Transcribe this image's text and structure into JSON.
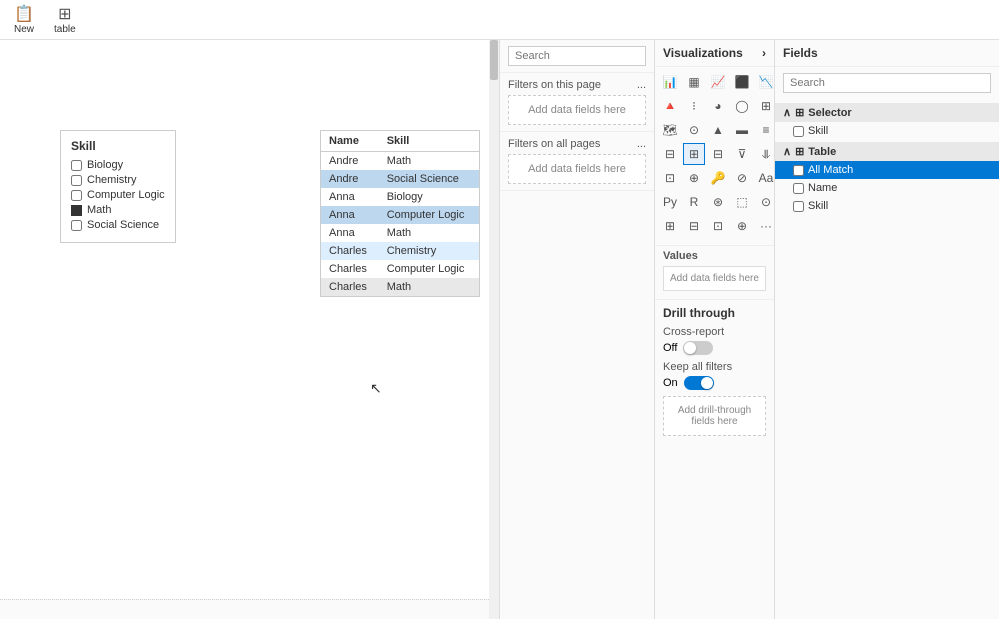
{
  "toolbar": {
    "new_button_label": "New",
    "table_button_label": "table"
  },
  "slicer": {
    "title": "Skill",
    "items": [
      {
        "label": "Biology",
        "checked": false
      },
      {
        "label": "Chemistry",
        "checked": false
      },
      {
        "label": "Computer Logic",
        "checked": false
      },
      {
        "label": "Math",
        "checked": true,
        "filled": true
      },
      {
        "label": "Social Science",
        "checked": false
      }
    ]
  },
  "table": {
    "columns": [
      "Name",
      "Skill"
    ],
    "rows": [
      {
        "name": "Andre",
        "skill": "Math",
        "highlight": ""
      },
      {
        "name": "Andre",
        "skill": "Social Science",
        "highlight": "blue"
      },
      {
        "name": "Anna",
        "skill": "Biology",
        "highlight": ""
      },
      {
        "name": "Anna",
        "skill": "Computer Logic",
        "highlight": "blue"
      },
      {
        "name": "Anna",
        "skill": "Math",
        "highlight": ""
      },
      {
        "name": "Charles",
        "skill": "Chemistry",
        "highlight": "light"
      },
      {
        "name": "Charles",
        "skill": "Computer Logic",
        "highlight": ""
      },
      {
        "name": "Charles",
        "skill": "Math",
        "highlight": "gray"
      }
    ]
  },
  "filters": {
    "search_placeholder": "Search",
    "filters_on_page_label": "Filters on this page",
    "filters_on_page_dots": "...",
    "filters_all_pages_label": "Filters on all pages",
    "filters_all_pages_dots": "...",
    "add_data_fields_label": "Add data fields here",
    "add_data_fields_label2": "Add data fields here"
  },
  "visualizations": {
    "panel_title": "Visualizations",
    "chevron_label": ">",
    "icons": [
      "bar-chart",
      "stacked-bar",
      "column-chart",
      "stacked-column",
      "line-chart",
      "area-chart",
      "scatter-chart",
      "pie-chart",
      "donut-chart",
      "treemap",
      "map-chart",
      "gauge-chart",
      "kpi",
      "card",
      "multi-row-card",
      "slicer",
      "table",
      "matrix",
      "funnel",
      "waterfall",
      "ribbon-chart",
      "decomp-tree",
      "key-influencers",
      "shape-map",
      "custom1",
      "custom2",
      "custom3",
      "py-icon",
      "r-icon",
      "custom4",
      "custom5",
      "custom6",
      "custom7",
      "custom8",
      "dots-icon"
    ],
    "values_label": "Values",
    "add_data_fields_label": "Add data fields here",
    "drill_through_title": "Drill through",
    "cross_report_label": "Cross-report",
    "cross_report_state": "Off",
    "keep_all_filters_label": "Keep all filters",
    "keep_all_filters_state": "On",
    "add_drill_through_label": "Add drill-through fields here"
  },
  "fields": {
    "panel_title": "Fields",
    "search_placeholder": "Search",
    "groups": [
      {
        "name": "Selector",
        "icon": "table-icon",
        "active": true,
        "items": [
          {
            "label": "Skill",
            "checked": false
          }
        ]
      },
      {
        "name": "Table",
        "icon": "table-icon",
        "active": false,
        "items": [
          {
            "label": "All Match",
            "checked": false,
            "active": true
          },
          {
            "label": "Name",
            "checked": false
          },
          {
            "label": "Skill",
            "checked": false
          }
        ]
      }
    ]
  }
}
